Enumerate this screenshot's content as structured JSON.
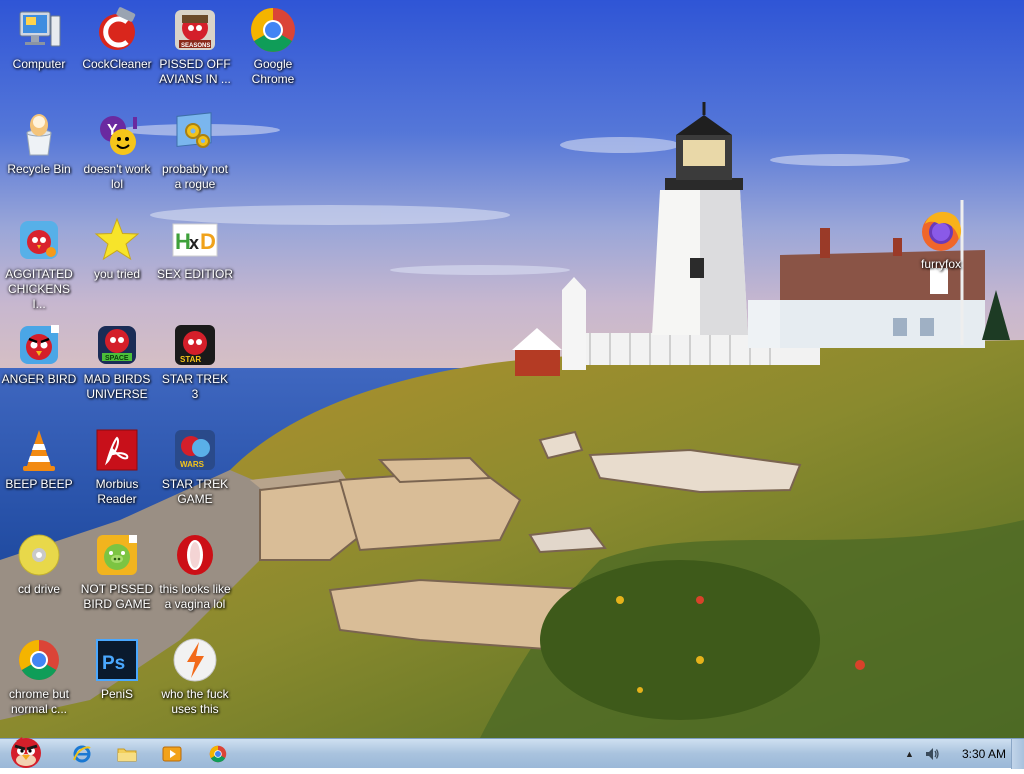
{
  "desktop": {
    "icons": [
      {
        "label": "Computer",
        "icon": "computer-icon"
      },
      {
        "label": "CockCleaner",
        "icon": "ccleaner-icon"
      },
      {
        "label": "PISSED OFF AVIANS IN ...",
        "icon": "angry-birds-seasons-icon"
      },
      {
        "label": "Google Chrome",
        "icon": "chrome-icon"
      },
      {
        "label": "Recycle Bin",
        "icon": "recycle-bin-icon"
      },
      {
        "label": "doesn't work lol",
        "icon": "yahoo-messenger-icon"
      },
      {
        "label": "probably not a rogue",
        "icon": "control-panel-gears-icon"
      },
      {
        "label": "AGGITATED CHICKENS I...",
        "icon": "angry-birds-rio-icon"
      },
      {
        "label": "you tried",
        "icon": "star-icon"
      },
      {
        "label": "SEX EDITIOR",
        "icon": "hxd-hex-editor-icon"
      },
      {
        "label": "ANGER BIRD",
        "icon": "angry-birds-icon"
      },
      {
        "label": "MAD BIRDS UNIVERSE",
        "icon": "angry-birds-space-icon"
      },
      {
        "label": "STAR TREK 3",
        "icon": "angry-birds-star-wars-icon"
      },
      {
        "label": "BEEP BEEP",
        "icon": "vlc-icon"
      },
      {
        "label": "Morbius Reader",
        "icon": "adobe-reader-icon"
      },
      {
        "label": "STAR TREK GAME",
        "icon": "angry-birds-star-wars-2-icon"
      },
      {
        "label": "cd drive",
        "icon": "cd-drive-icon"
      },
      {
        "label": "NOT PISSED BIRD GAME",
        "icon": "bad-piggies-icon"
      },
      {
        "label": "this looks like a vagina lol",
        "icon": "opera-icon"
      },
      {
        "label": "chrome but normal c...",
        "icon": "chrome-canary-icon"
      },
      {
        "label": "PeniS",
        "icon": "photoshop-icon"
      },
      {
        "label": "who the fuck uses this",
        "icon": "avast-icon"
      },
      {
        "label": "furryfox",
        "icon": "firefox-icon"
      }
    ]
  },
  "taskbar": {
    "start_icon": "angry-bird-start-icon",
    "pinned": [
      {
        "name": "internet-explorer-icon"
      },
      {
        "name": "file-explorer-icon"
      },
      {
        "name": "media-player-icon"
      },
      {
        "name": "chrome-icon"
      }
    ],
    "tray": {
      "clock": "3:30 AM",
      "icons": [
        "show-hidden-icons-chevron-icon",
        "volume-icon"
      ]
    }
  },
  "colors": {
    "taskbar_top": "#cfe0f1",
    "taskbar_bottom": "#9bb8d8",
    "sky": "#3a5fd0",
    "sea": "#2f5bb5"
  }
}
